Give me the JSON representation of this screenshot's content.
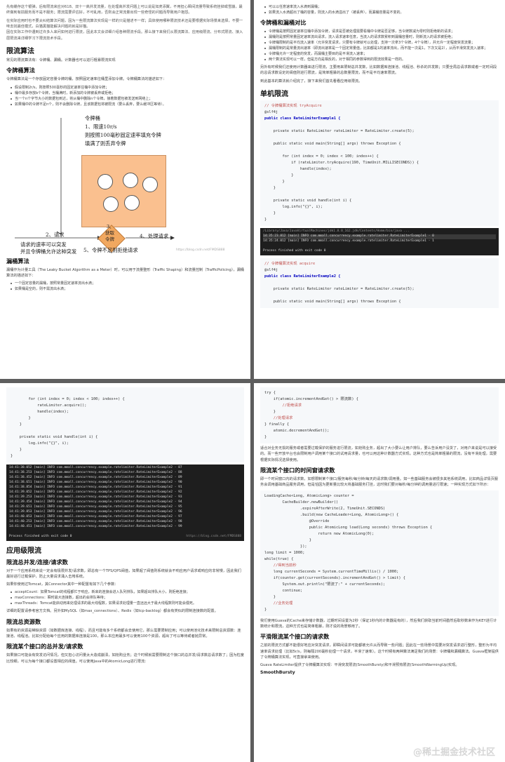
{
  "p1": {
    "intro1": "先有缓存这个银弹，后有限流来应对618、双十一高并发流量，在处理高并发问题上可以说是如虎添翼，不用担心瞬间流量导致系统挂掉或雪崩，最终做到有损服务而不是不服务；限流需要评估好，不可乱用，否则会正常流量出现一些奇怪的问题而导致用户抱怨。",
    "intro2": "在实际应用时也不要太纠结算法问题，因为一些限流算法实现是一样的只是描述不一样；具体使用哪种限流技术还是要根据实际场景来选择，不要一味去找最佳模式，白猫黑猫能解决问题的就是好猫。",
    "intro3": "因在实际工作中遇到过许多人来问如何进行限流，因此本文会详细介绍各种限流手段。那么接下来我们从限流算法、应用级限流、分布式限流、接入层限流来详细学习下限流技术手段。",
    "h_algo": "限流算法",
    "algo_intro": "常见的限流算法有：令牌桶、漏桶。计数器也可以进行粗暴限流实现",
    "h_token": "令牌桶算法",
    "token_intro": "令牌桶算法是一个存放固定容量令牌的桶，按照固定速率往桶里添加令牌。令牌桶算法的描述如下：",
    "token_list": [
      "假设限制2r/s，则按照500毫秒的固定速率往桶中添加令牌；",
      "桶中最多存放b个令牌，当桶满时，新添加的令牌被丢弃或拒绝；",
      "当一个n个字节大小的数据包到达，将从桶中删除n个令牌，接着数据包被发送到网络上；",
      "如果桶中的令牌不足n个，则不会删除令牌，且该数据包将被限流（要么丢弃，要么缓冲区等待）。"
    ],
    "fig": {
      "title": "令牌桶",
      "line1": "1、限速10r/s",
      "line2": "则按照100毫秒固定速率填充令牌",
      "line3": "填满了则丢弃令牌",
      "step2": "2、请求",
      "step2a": "请求的速率可以突发",
      "step2b": "并且令牌桶允许这种突发",
      "step3a": "3、",
      "step3b": "获取",
      "step3c": "令牌",
      "step4": "4、处理请求",
      "step5": "5、令牌不足则拒绝请求",
      "watermark": "https://blog.csdn.net/FMDS888"
    },
    "h_leaky": "漏桶算法",
    "leaky_intro": "漏桶作为计量工具（The Leaky Bucket Algorithm as a Meter）时，可以用于流量整形（Traffic Shaping）和流量控制（TrafficPolicing），漏桶算法的描述如下：",
    "leaky_list": [
      "一个固定容量的漏桶，按照常量固定速率流出水滴；",
      "如果桶是空的，则不需流出水滴；"
    ]
  },
  "p2": {
    "top_list": [
      "可以以任意速率流入水滴到漏桶；",
      "如果流入水滴超出了桶的容量，则流入的水滴溢出了（被丢弃），而漏桶容量是不变的。"
    ],
    "h_cmp": "令牌桶和漏桶对比",
    "cmp_list": [
      "令牌桶是按照固定速率往桶中添加令牌，请求是否被处理需要看桶中令牌是否足够，当令牌数减为零时则拒绝新的请求；",
      "漏桶则是按照常量固定速率流出请求，流入请求速率任意，当流入的请求数累积到漏桶容量时，则新流入的请求被拒绝；",
      "令牌桶限制的是平均流入速率（允许突发请求，只要有令牌就可以处理，支持一次拿3个令牌，4个令牌），并允许一定程度突发流量；",
      "漏桶限制的是常量流出速率（即流出速率是一个固定常量值，比如都是1的速率流出，而不能一次是1，下次又是2），从而平滑突发流入速率；",
      "令牌桶允许一定程度的突发，而漏桶主要目的是平滑流入速率；",
      "两个算法实现可以一样，但是方向是相反的，对于相同的参数得到的限流效果是一样的。"
    ],
    "cmp_p1": "另外有时候我们还使用计数器来进行限流，主要用来限制总并发数，比如数据库连接池、线程池、秒杀的并发数；只要全局总请求数或者一定时间段的总请求数设定的阀值则进行限流，是简单粗暴的总数量限流，而不是平均速率限流。",
    "cmp_p2": "到此基本的算法就介绍完了，接下来我们首先看看应用级限流。",
    "h_single": "单机限流",
    "code1_lines": [
      "// 令牌桶算法实现 tryAcquire",
      "@slf4j",
      "public class RateLimiterExample1 {",
      "",
      "    private static RateLimiter rateLimiter = RateLimiter.create(5);",
      "",
      "    public static void main(String[] args) throws Exception {",
      "",
      "        for (int index = 0; index < 100; index++) {",
      "            if (rateLimiter.tryAcquire(190, TimeUnit.MILLISECONDS)) {",
      "                handle(index);",
      "            }",
      "        }",
      "    }",
      "",
      "    private static void handle(int i) {",
      "        log.info(\"{}\", i);",
      "    }",
      "}"
    ],
    "term1_header": "/Library/Java/JavaVirtualMachines/jdk1.8.0_162.jdk/Contents/Home/bin/java ...",
    "term1_lines": [
      "14:35:23.812 [main] INFO com.mmall.concurrency.example.ratelimiter.RateLimiterExample1 - 0",
      "14:35:24.012 [main] INFO com.mmall.concurrency.example.ratelimiter.RateLimiterExample1 - 1"
    ],
    "term1_footer": "Process finished with exit code 0",
    "code2_lines": [
      "// 令牌桶算法实现 acquire",
      "@slf4j",
      "public class RateLimiterExample2 {",
      "",
      "    private static RateLimiter rateLimiter = RateLimiter.create(5);",
      "",
      "    public static void main(String[] args) throws Exception {"
    ]
  },
  "p3": {
    "code3_lines": [
      "",
      "        for (int index = 0; index < 100; index++) {",
      "            rateLimiter.acquire();",
      "            handle(index);",
      "        }",
      "    }",
      "",
      "    private static void handle(int i) {",
      "        log.info(\"{}\", i);",
      "    }",
      "}"
    ],
    "term2_lines": [
      "14:41:38.052 [main] INFO com.mmall.concurrency.example.ratelimiter.RateLimiterExample2 - 87",
      "14:41:38.253 [main] INFO com.mmall.concurrency.example.ratelimiter.RateLimiterExample2 - 88",
      "14:41:38.452 [main] INFO com.mmall.concurrency.example.ratelimiter.RateLimiterExample2 - 89",
      "14:41:38.651 [main] INFO com.mmall.concurrency.example.ratelimiter.RateLimiterExample2 - 90",
      "14:41:38.854 [main] INFO com.mmall.concurrency.example.ratelimiter.RateLimiterExample2 - 91",
      "14:41:39.052 [main] INFO com.mmall.concurrency.example.ratelimiter.RateLimiterExample2 - 92",
      "14:41:39.253 [main] INFO com.mmall.concurrency.example.ratelimiter.RateLimiterExample2 - 93",
      "14:41:39.454 [main] INFO com.mmall.concurrency.example.ratelimiter.RateLimiterExample2 - 94",
      "14:41:39.651 [main] INFO com.mmall.concurrency.example.ratelimiter.RateLimiterExample2 - 95",
      "14:41:39.853 [main] INFO com.mmall.concurrency.example.ratelimiter.RateLimiterExample2 - 96",
      "14:41:40.053 [main] INFO com.mmall.concurrency.example.ratelimiter.RateLimiterExample2 - 97",
      "14:41:40.253 [main] INFO com.mmall.concurrency.example.ratelimiter.RateLimiterExample2 - 98",
      "14:41:40.451 [main] INFO com.mmall.concurrency.example.ratelimiter.RateLimiterExample2 - 99"
    ],
    "term2_footer": "Process finished with exit code 0",
    "term2_watermark": "https://blog.csdn.net/FMDS888",
    "h_app": "应用级限流",
    "h_total": "限流总并发/连接/请求数",
    "total_p1": "对于一个应用系统来说一定会有极限并发/请求数，即总有一个TPS/QPS阀值，如果超了阀值则系统就会不响应用户请求或响应的非常慢，因此我们最好进行过载保护，防止大量请求涌入击垮系统。",
    "total_p2": "如果你使用过Tomcat，其Connector其中一种配置有如下几个参数：",
    "tomcat_list": [
      "acceptCount：如果Tomcat的线程都忙于响应，新来的连接会进入队列排队，如果超出排队大小，则拒绝连接；",
      "maxConnections：瞬时最大连接数，超出的会排队等待；",
      "maxThreads：Tomcat能启动用来处理请求的最大线程数，如果请求处理量一直远远大于最大线程数则可能会僵死。"
    ],
    "total_p3": "详细的配置请参考官方文档。另外如MySQL（如max_connections）、Redis（如tcp-backlog）都会有类似的限制连接数的配置。",
    "h_res": "限流总资源数",
    "res_p": "如果有的资源是稀缺资源（如数据库连接、线程），而且可能有多个系统都会去使用它，那么需要限制应用；可以使用池化技术来限制总资源数：连接池、线程池。比如分配给每个应用的数据库连接是100，那么本应用最多可以使用100个资源，超出了可以等待或者抛异常。",
    "h_iface": "限流某个接口的总并发/请求数",
    "iface_p": "如果接口可能会有突发访问情况，但又担心访问量太大造成崩溃，如抢购业务；这个时候就需要限制这个接口的总并发/请求数总请求数了；因为粒度比较细，可以为每个接口都设置相应的阀值。可以使用Java中的AtomicLong进行限流："
  },
  "p4": {
    "code4_lines": [
      "try {",
      "    if(atomic.incrementAndGet() > 限流数) {",
      "        //拒绝请求",
      "    }",
      "    //处理请求",
      "} finally {",
      "    atomic.decrementAndGet();",
      "}"
    ],
    "p_after": "适合对业务无损的服务或者需要过载保护的服务进行限流，如抢购业务，超出了大小要么让用户排队，要么告诉用户没货了，对用户来说是可以接受的。而一些开放平台也会限制用户调用某个接口的试用请求量，也可以用这种计数器方式实现。这种方式也是简单粗暴的限流，没有平滑处理，需要根据实际情况选择使用。",
    "h_window": "限流某个接口的时间窗请求数",
    "window_p": "即一个时间窗口内的请求数，如想限制某个接口/服务每秒/每分钟/每天的请求数/调用量。如一些基础服务会被很多其他系统调用，比如商品详情页服务会调用基础商品服务调用，但是怕因为更新量比较大将基础服务打挂，这时我们要对每秒/每分钟的调用量进行限速；一种实现方式如下所示：",
    "code5_lines": [
      "LoadingCache<Long, AtomicLong> counter =",
      "        CacheBuilder.newBuilder()",
      "                .expireAfterWrite(2, TimeUnit.SECONDS)",
      "                .build(new CacheLoader<Long, AtomicLong>() {",
      "                    @Override",
      "                    public AtomicLong load(Long seconds) throws Exception {",
      "                        return new AtomicLong(0);",
      "                    }",
      "                });",
      "long limit = 1000;",
      "while(true) {",
      "    //得到当前秒",
      "    long currentSeconds = System.currentTimeMillis() / 1000;",
      "    if(counter.get(currentSeconds).incrementAndGet() > limit) {",
      "        System.out.println(\"限流了:\" + currentSeconds);",
      "        continue;",
      "    }",
      "    //业务处理",
      "}"
    ],
    "p_guava": "我们使用Guava的Cache来存储计数器，过期时间设置为2秒（保证1秒内的计数器是有的），然后我们获取当前时间戳然后取秒数来作为KEY进行计数统计和限流，这种方式也是简单粗暴，刚才说的场景够用了。",
    "h_smooth": "平滑限流某个接口的请求数",
    "smooth_p1": "之前的限流方式都不能很好地应对突发请求，即瞬间请求可能都被允许从而导致一些问题；因此在一些场景中需要对突发请求进行整形，整形为平均速率请求处理（比如5r/s，则每隔200毫秒处理一个请求，平滑了速率）。这个时候有两种算法满足我们的场景：令牌桶和漏桶算法。Guava框架提供了令牌桶算法实现，可直接拿来使用。",
    "smooth_p2": "Guava RateLimiter提供了令牌桶算法实现：平滑突发限流(SmoothBursty)和平滑预热限流(SmoothWarmingUp)实现。",
    "h_bursty": "SmoothBursty",
    "watermark": "@稀土掘金技术社区"
  }
}
